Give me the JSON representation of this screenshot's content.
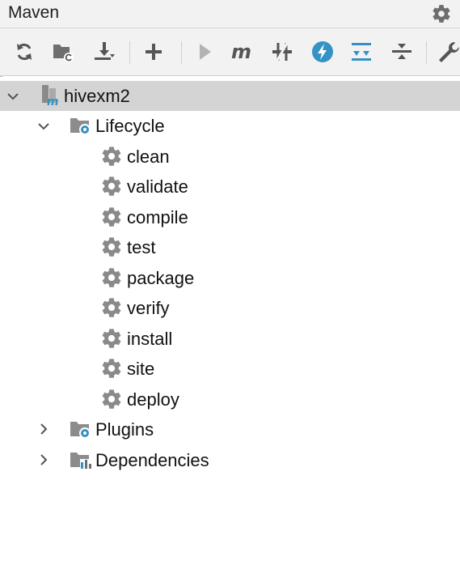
{
  "window": {
    "title": "Maven"
  },
  "icons": {
    "settings": "gear-icon",
    "toolbar": [
      "refresh-icon",
      "reimport-folder-icon",
      "download-icon",
      "add-icon",
      "run-icon",
      "maven-m-icon",
      "skip-tests-icon",
      "lightning-icon",
      "expand-all-icon",
      "collapse-all-icon",
      "wrench-icon"
    ]
  },
  "tree": {
    "project": {
      "label": "hivexm2",
      "expanded": true,
      "selected": true
    },
    "lifecycle": {
      "label": "Lifecycle",
      "expanded": true,
      "goals": [
        "clean",
        "validate",
        "compile",
        "test",
        "package",
        "verify",
        "install",
        "site",
        "deploy"
      ]
    },
    "plugins": {
      "label": "Plugins",
      "expanded": false
    },
    "dependencies": {
      "label": "Dependencies",
      "expanded": false
    }
  },
  "colors": {
    "accent": "#3592c4",
    "icon_gray": "#6e6e6e",
    "selection": "#d4d4d4"
  }
}
